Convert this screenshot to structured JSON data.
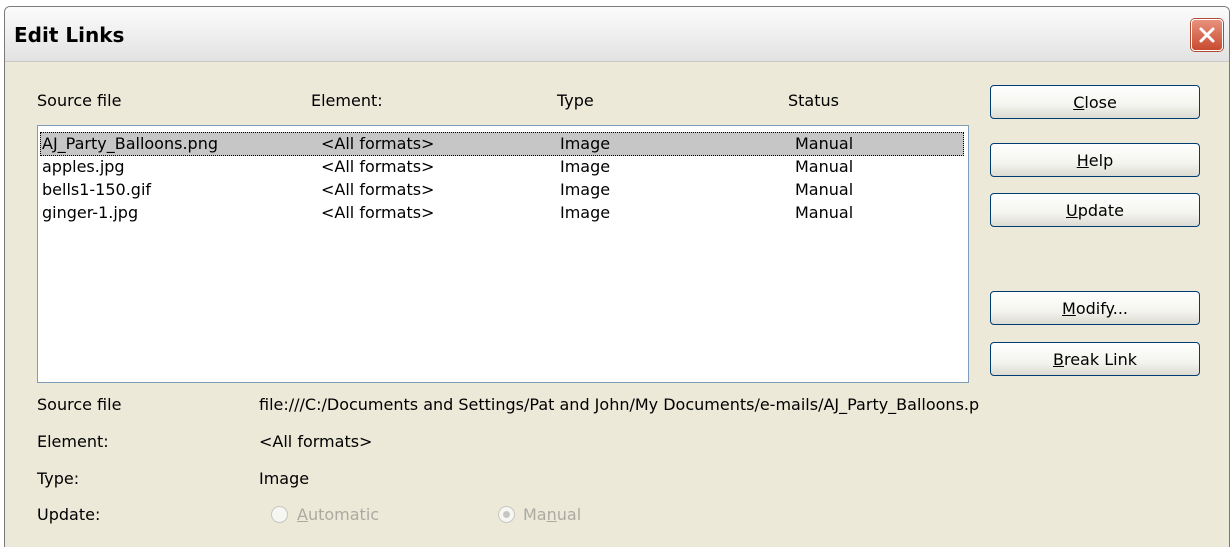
{
  "window": {
    "title": "Edit Links"
  },
  "table": {
    "headers": [
      "Source file",
      "Element:",
      "Type",
      "Status"
    ],
    "rows": [
      [
        "AJ_Party_Balloons.png",
        "<All formats>",
        "Image",
        "Manual"
      ],
      [
        "apples.jpg",
        "<All formats>",
        "Image",
        "Manual"
      ],
      [
        "bells1-150.gif",
        "<All formats>",
        "Image",
        "Manual"
      ],
      [
        "ginger-1.jpg",
        "<All formats>",
        "Image",
        "Manual"
      ]
    ],
    "selected_index": 0
  },
  "buttons": {
    "close": {
      "accel": "C",
      "rest": "lose"
    },
    "help": {
      "accel": "H",
      "rest": "elp"
    },
    "update": {
      "accel": "U",
      "rest": "pdate"
    },
    "modify": {
      "accel": "M",
      "rest": "odify..."
    },
    "break_link": {
      "accel": "B",
      "rest": "reak Link"
    }
  },
  "details": {
    "source_file_label": "Source file",
    "source_file_value": "file:///C:/Documents and Settings/Pat and John/My Documents/e-mails/AJ_Party_Balloons.p",
    "element_label": "Element:",
    "element_value": "<All formats>",
    "type_label": "Type:",
    "type_value": "Image",
    "update_label": "Update:"
  },
  "update_options": {
    "automatic": {
      "accel": "A",
      "rest": "utomatic",
      "selected": false
    },
    "manual": {
      "pre": "Ma",
      "accel": "n",
      "rest": "ual",
      "selected": true
    }
  },
  "colors": {
    "close_button": "#d35a3f",
    "selection": "#c6c6c6",
    "dialog_bg": "#ece9d8"
  },
  "icons": {
    "title_close": "close-x-icon"
  }
}
